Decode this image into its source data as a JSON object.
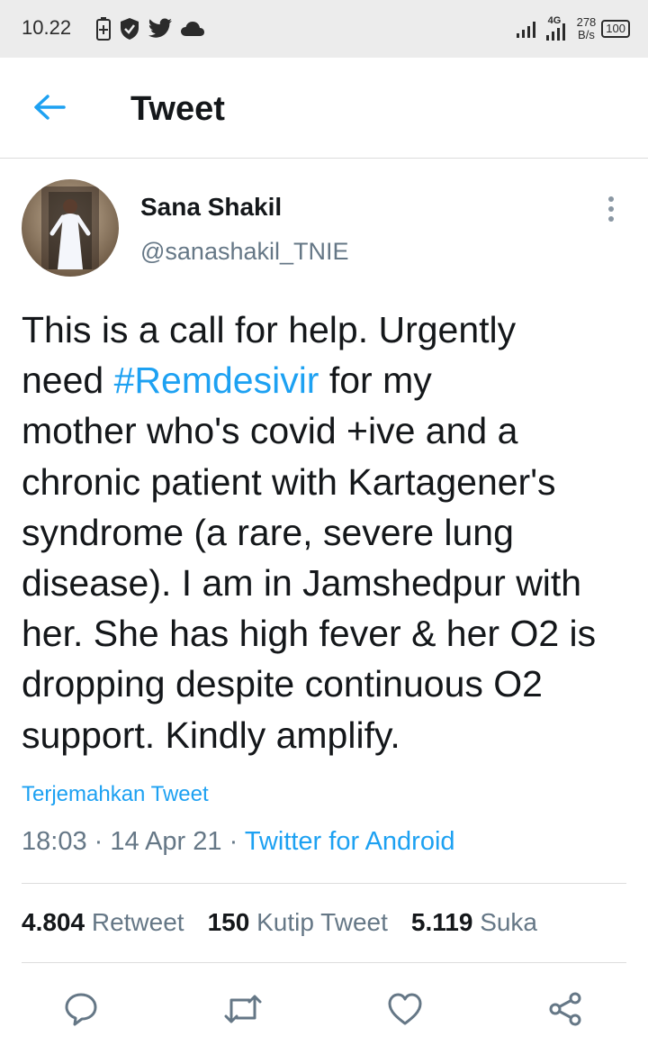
{
  "status_bar": {
    "time": "10.22",
    "left_icons": [
      "battery-saver-icon",
      "shield-icon",
      "twitter-bird-icon",
      "cloud-icon"
    ],
    "network": "4G",
    "speed_value": "278",
    "speed_unit": "B/s",
    "battery": "100"
  },
  "header": {
    "back_icon": "back-arrow-icon",
    "title": "Tweet"
  },
  "tweet": {
    "author_name": "Sana Shakil",
    "author_handle": "@sanashakil_TNIE",
    "text_before_hashtag": "This is a call for help. Urgently\nneed ",
    "hashtag": "#Remdesivir",
    "text_after_hashtag": " for my\nmother who's covid +ive and a\nchronic patient with Kartagener's\nsyndrome (a rare, severe lung\ndisease). I am in Jamshedpur with\nher. She has high fever & her O2 is\ndropping despite continuous O2\nsupport. Kindly amplify.",
    "translate_label": "Terjemahkan Tweet",
    "time": "18:03",
    "separator": "·",
    "date": "14 Apr 21",
    "source": "Twitter for Android"
  },
  "stats": {
    "retweets_count": "4.804",
    "retweets_label": "Retweet",
    "quotes_count": "150",
    "quotes_label": "Kutip Tweet",
    "likes_count": "5.119",
    "likes_label": "Suka"
  },
  "actions": [
    "reply-icon",
    "retweet-icon",
    "like-icon",
    "share-icon"
  ],
  "colors": {
    "accent": "#1da1f2",
    "text": "#14171a",
    "secondary": "#657786",
    "divider": "#dcdcdc",
    "status_bar_bg": "#ececec"
  }
}
